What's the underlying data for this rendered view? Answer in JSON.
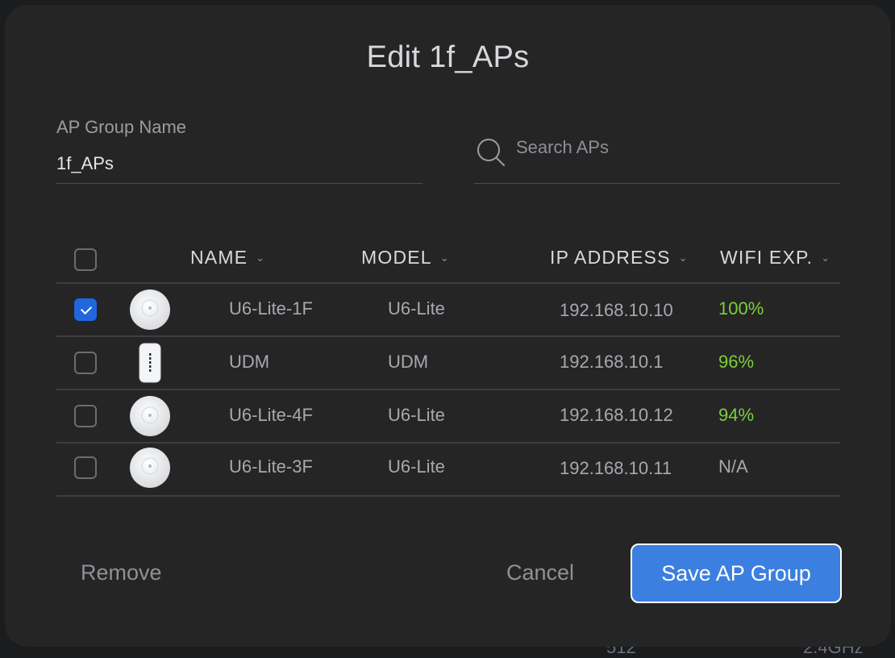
{
  "dialog": {
    "title": "Edit 1f_APs"
  },
  "form": {
    "group_name_label": "AP Group Name",
    "group_name_value": "1f_APs",
    "search_placeholder": "Search APs",
    "search_value": ""
  },
  "table": {
    "headers": [
      "NAME",
      "MODEL",
      "IP ADDRESS",
      "WIFI EXP."
    ],
    "select_all_checked": false,
    "rows": [
      {
        "checked": true,
        "device_icon": "u6-lite-icon",
        "name": "U6-Lite-1F",
        "model": "U6-Lite",
        "ip": "192.168.10.10",
        "wifi_exp": "100%",
        "exp_status": "good"
      },
      {
        "checked": false,
        "device_icon": "udm-icon",
        "name": "UDM",
        "model": "UDM",
        "ip": "192.168.10.1",
        "wifi_exp": "96%",
        "exp_status": "good"
      },
      {
        "checked": false,
        "device_icon": "u6-lite-icon",
        "name": "U6-Lite-4F",
        "model": "U6-Lite",
        "ip": "192.168.10.12",
        "wifi_exp": "94%",
        "exp_status": "good"
      },
      {
        "checked": false,
        "device_icon": "u6-lite-icon",
        "name": "U6-Lite-3F",
        "model": "U6-Lite",
        "ip": "192.168.10.11",
        "wifi_exp": "N/A",
        "exp_status": "na"
      }
    ]
  },
  "actions": {
    "remove_label": "Remove",
    "cancel_label": "Cancel",
    "save_label": "Save AP Group"
  },
  "colors": {
    "accent": "#3b7fe0",
    "checkbox_checked": "#2266dd",
    "exp_good": "#7ccf3b",
    "dialog_bg": "#252526"
  },
  "backdrop": {
    "left_text": "512",
    "right_text": "2.4GHz"
  }
}
